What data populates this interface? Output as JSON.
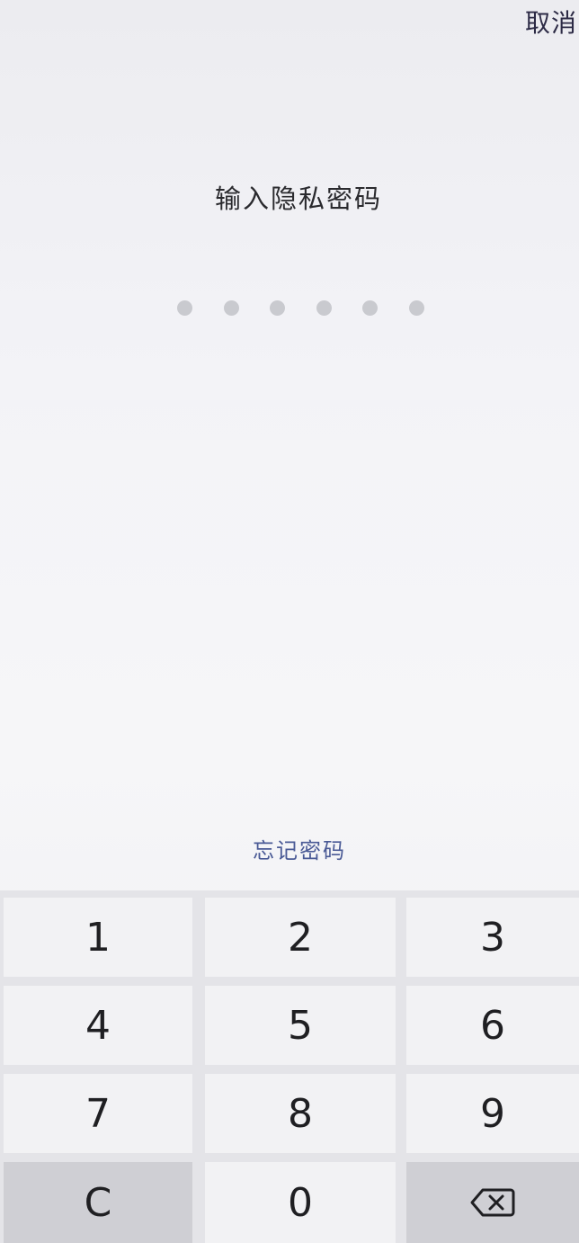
{
  "header": {
    "cancel_label": "取消"
  },
  "main": {
    "title": "输入隐私密码",
    "pin_length": 6,
    "pin_entered": 0,
    "forgot_label": "忘记密码"
  },
  "keypad": {
    "keys": [
      "1",
      "2",
      "3",
      "4",
      "5",
      "6",
      "7",
      "8",
      "9",
      "C",
      "0"
    ],
    "backspace_icon": "backspace-icon"
  },
  "colors": {
    "title": "#2a2a2e",
    "link": "#4a5a96",
    "dot": "#c9cacf"
  }
}
